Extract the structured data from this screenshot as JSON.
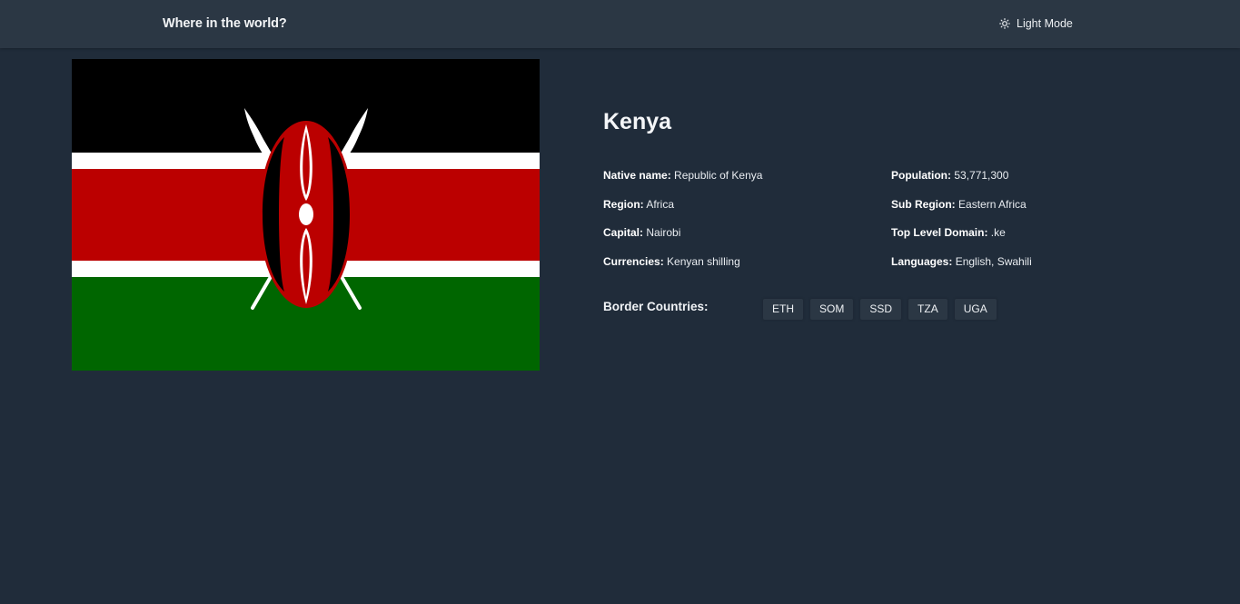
{
  "header": {
    "title": "Where in the world?",
    "theme_toggle_label": "Light Mode",
    "theme_icon": "sun-icon"
  },
  "flag": {
    "country": "Kenya",
    "colors": [
      "#000000",
      "#ffffff",
      "#bb0000",
      "#006600"
    ]
  },
  "country": {
    "name": "Kenya",
    "facts_left": [
      {
        "label": "Native name:",
        "value": "Republic of Kenya"
      },
      {
        "label": "Region:",
        "value": "Africa"
      },
      {
        "label": "Capital:",
        "value": "Nairobi"
      },
      {
        "label": "Currencies:",
        "value": "Kenyan shilling"
      }
    ],
    "facts_right": [
      {
        "label": "Population:",
        "value": "53,771,300"
      },
      {
        "label": "Sub Region:",
        "value": "Eastern Africa"
      },
      {
        "label": "Top Level Domain:",
        "value": ".ke"
      },
      {
        "label": "Languages:",
        "value": "English, Swahili"
      }
    ],
    "border_label": "Border Countries:",
    "borders": [
      "ETH",
      "SOM",
      "SSD",
      "TZA",
      "UGA"
    ]
  },
  "colors": {
    "background": "#202c3a",
    "surface": "#2b3744",
    "text": "#ffffff"
  }
}
